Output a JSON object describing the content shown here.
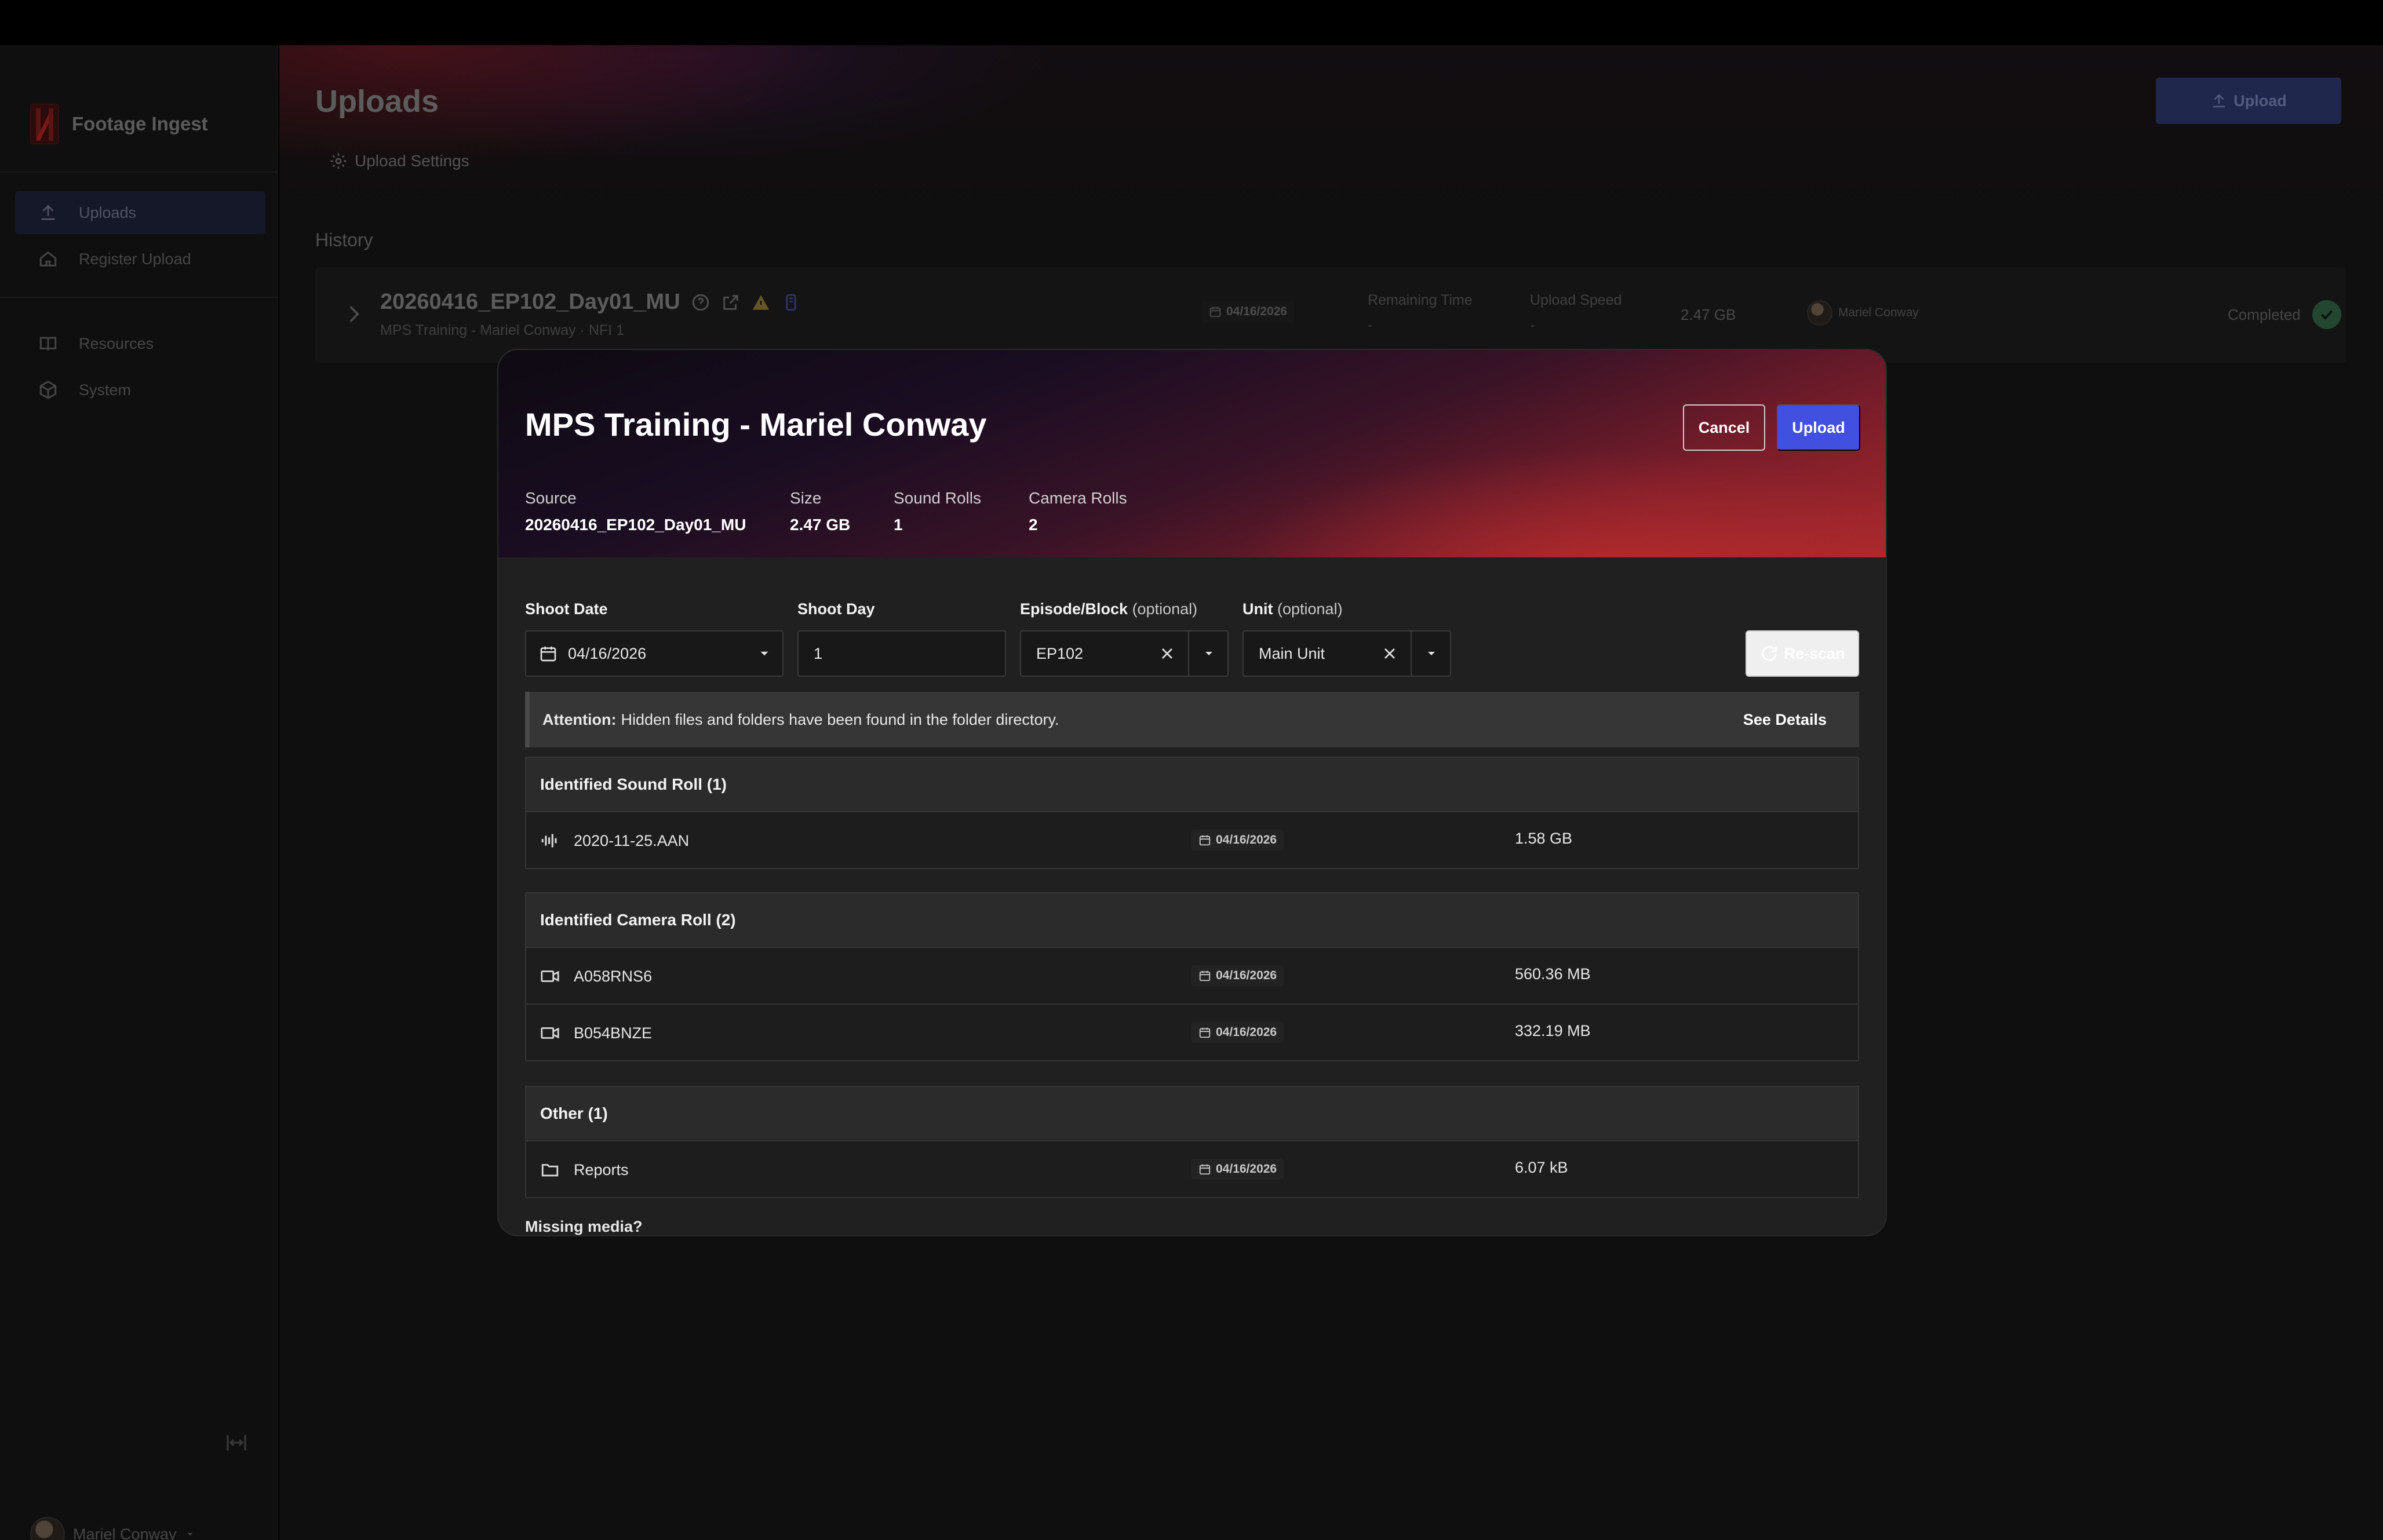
{
  "app": {
    "name": "Footage Ingest"
  },
  "sidebar": {
    "items": [
      {
        "label": "Uploads",
        "icon": "upload-icon",
        "active": true
      },
      {
        "label": "Register Upload",
        "icon": "home-icon",
        "active": false
      },
      {
        "label": "Resources",
        "icon": "book-icon",
        "active": false
      },
      {
        "label": "System",
        "icon": "box-icon",
        "active": false
      }
    ],
    "user": {
      "name": "Mariel Conway"
    }
  },
  "page": {
    "title": "Uploads",
    "settings_label": "Upload Settings",
    "upload_button": "Upload",
    "history_label": "History"
  },
  "history": [
    {
      "name": "20260416_EP102_Day01_MU",
      "subtitle": "MPS Training - Mariel Conway · NFI 1",
      "date": "04/16/2026",
      "remaining_label": "Remaining Time",
      "remaining_value": "-",
      "speed_label": "Upload Speed",
      "speed_value": "-",
      "size": "2.47 GB",
      "user": "Mariel Conway",
      "status": "Completed"
    }
  ],
  "modal": {
    "title": "MPS Training - Mariel Conway",
    "cancel": "Cancel",
    "upload": "Upload",
    "meta": [
      {
        "label": "Source",
        "value": "20260416_EP102_Day01_MU"
      },
      {
        "label": "Size",
        "value": "2.47 GB"
      },
      {
        "label": "Sound Rolls",
        "value": "1"
      },
      {
        "label": "Camera Rolls",
        "value": "2"
      }
    ],
    "form": {
      "shoot_date_label": "Shoot Date",
      "shoot_date_value": "04/16/2026",
      "shoot_day_label": "Shoot Day",
      "shoot_day_value": "1",
      "episode_label": "Episode/Block",
      "episode_optional": "(optional)",
      "episode_value": "EP102",
      "unit_label": "Unit",
      "unit_optional": "(optional)",
      "unit_value": "Main Unit",
      "rescan": "Re-scan"
    },
    "attention": {
      "prefix": "Attention:",
      "message": "Hidden files and folders have been found in the folder directory.",
      "link": "See Details"
    },
    "groups": [
      {
        "title": "Identified Sound Roll (1)",
        "rows": [
          {
            "icon": "waveform-icon",
            "name": "2020-11-25.AAN",
            "date": "04/16/2026",
            "size": "1.58 GB"
          }
        ]
      },
      {
        "title": "Identified Camera Roll (2)",
        "rows": [
          {
            "icon": "camera-icon",
            "name": "A058RNS6",
            "date": "04/16/2026",
            "size": "560.36 MB"
          },
          {
            "icon": "camera-icon",
            "name": "B054BNZE",
            "date": "04/16/2026",
            "size": "332.19 MB"
          }
        ]
      },
      {
        "title": "Other (1)",
        "rows": [
          {
            "icon": "folder-icon",
            "name": "Reports",
            "date": "04/16/2026",
            "size": "6.07 kB"
          }
        ]
      }
    ],
    "missing_media": "Missing media?"
  },
  "colors": {
    "accent": "#4250e0",
    "success": "#2e5e3f",
    "background": "#141414",
    "modal": "#202020"
  }
}
